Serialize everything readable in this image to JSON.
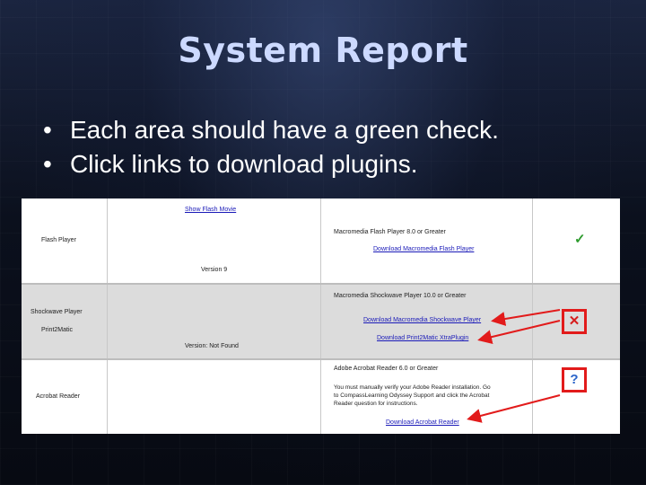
{
  "slide": {
    "title": "System Report",
    "bullets": [
      "Each area should have a green check.",
      "Click links to download plugins."
    ],
    "bullet_glyph": "•"
  },
  "report": {
    "rows": [
      {
        "name": "Flash Player",
        "top_link": "Show Flash Movie",
        "version": "Version 9",
        "requirement": "Macromedia Flash Player 8.0 or Greater",
        "download_link": "Download Macromedia Flash Player",
        "status_icon": "check-icon",
        "status_glyph": "✓"
      },
      {
        "name": "Shockwave Player",
        "sub_name": "Print2Matic",
        "version": "Version: Not Found",
        "requirement": "Macromedia Shockwave Player 10.0 or Greater",
        "download_link": "Download Macromedia Shockwave Player",
        "download_link_2": "Download Print2Matic XtraPlugin",
        "status_icon": "x-icon",
        "status_glyph": "✕"
      },
      {
        "name": "Acrobat Reader",
        "requirement": "Adobe Acrobat Reader 6.0 or Greater",
        "instructions": [
          "You must manually verify your Adobe Reader installation. Go",
          "to CompassLearning Odyssey Support and click the Acrobat",
          "Reader question for instructions."
        ],
        "download_link": "Download Acrobat Reader",
        "status_icon": "question-icon",
        "status_glyph": "?"
      }
    ]
  },
  "colors": {
    "title": "#ccd9ff",
    "check": "#2e9b2e",
    "x": "#d61c1c",
    "question": "#2a63c9",
    "annotation_red": "#e21b1b",
    "link": "#1a1ab8"
  }
}
